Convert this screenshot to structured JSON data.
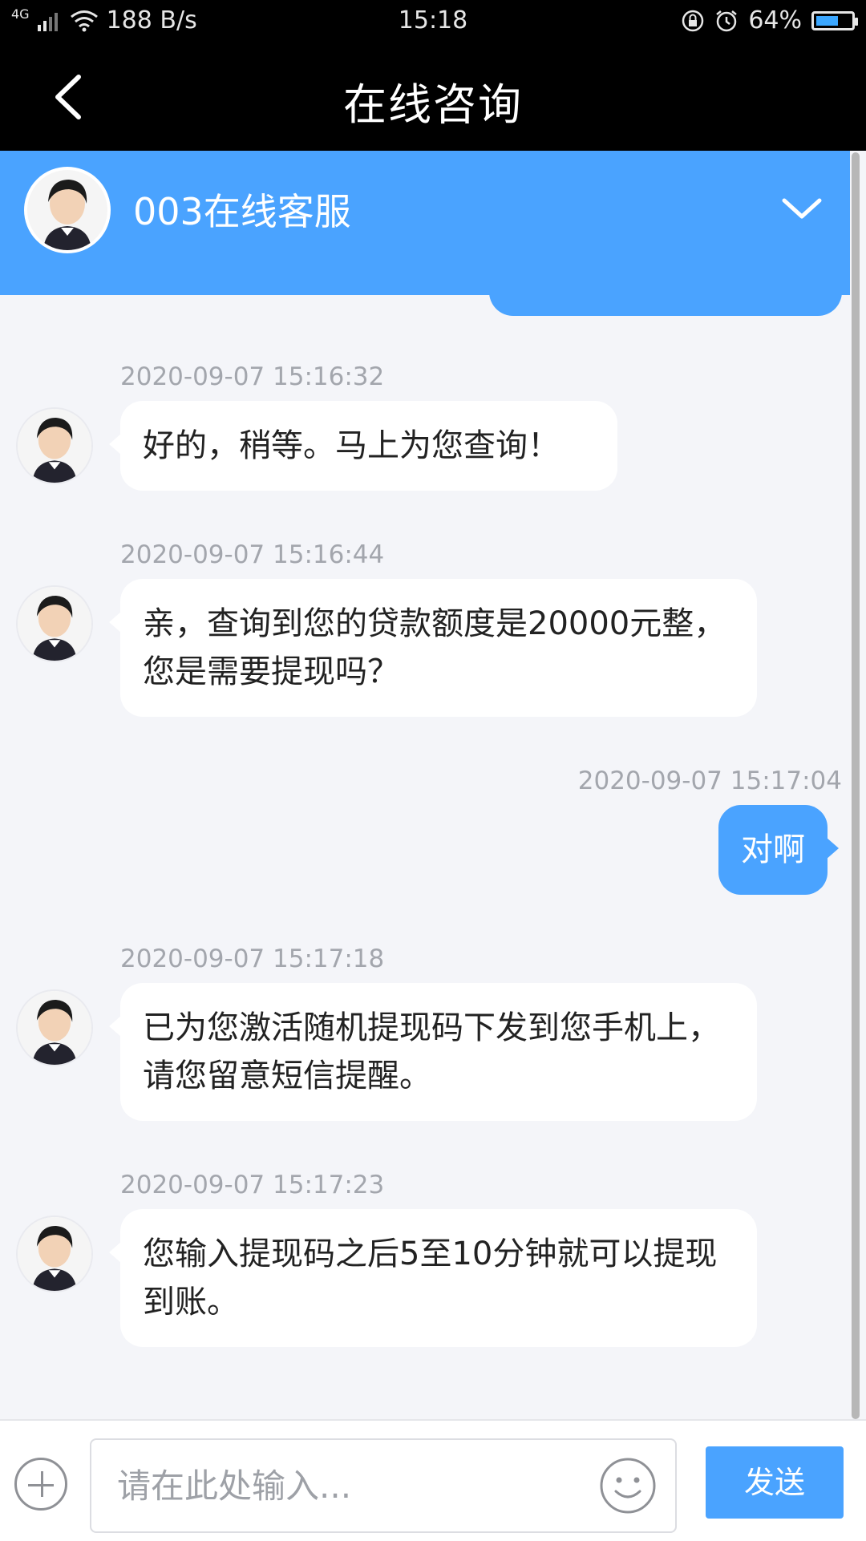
{
  "status_bar": {
    "network": "4G",
    "speed": "188 B/s",
    "time": "15:18",
    "battery": "64%",
    "battery_level": 0.64,
    "icons": [
      "signal-icon",
      "wifi-icon",
      "lock-rotation-icon",
      "alarm-icon",
      "battery-icon"
    ]
  },
  "header": {
    "title": "在线咨询",
    "back_icon": "back-arrow-icon"
  },
  "agent": {
    "name": "003在线客服",
    "dropdown_icon": "chevron-down-icon"
  },
  "messages": [
    {
      "from": "agent",
      "timestamp": "2020-09-07 15:16:32",
      "text": "好的，稍等。马上为您查询！"
    },
    {
      "from": "agent",
      "timestamp": "2020-09-07 15:16:44",
      "text": "亲，查询到您的贷款额度是20000元整，您是需要提现吗？"
    },
    {
      "from": "user",
      "timestamp": "2020-09-07 15:17:04",
      "text": "对啊"
    },
    {
      "from": "agent",
      "timestamp": "2020-09-07 15:17:18",
      "text": "已为您激活随机提现码下发到您手机上，请您留意短信提醒。"
    },
    {
      "from": "agent",
      "timestamp": "2020-09-07 15:17:23",
      "text": "您输入提现码之后5至10分钟就可以提现到账。"
    }
  ],
  "input_bar": {
    "placeholder": "请在此处输入...",
    "send_label": "发送",
    "icons": [
      "plus-icon",
      "emoji-icon"
    ]
  },
  "colors": {
    "accent": "#4aa3ff",
    "background": "#f4f5f9",
    "bar": "#000000"
  }
}
